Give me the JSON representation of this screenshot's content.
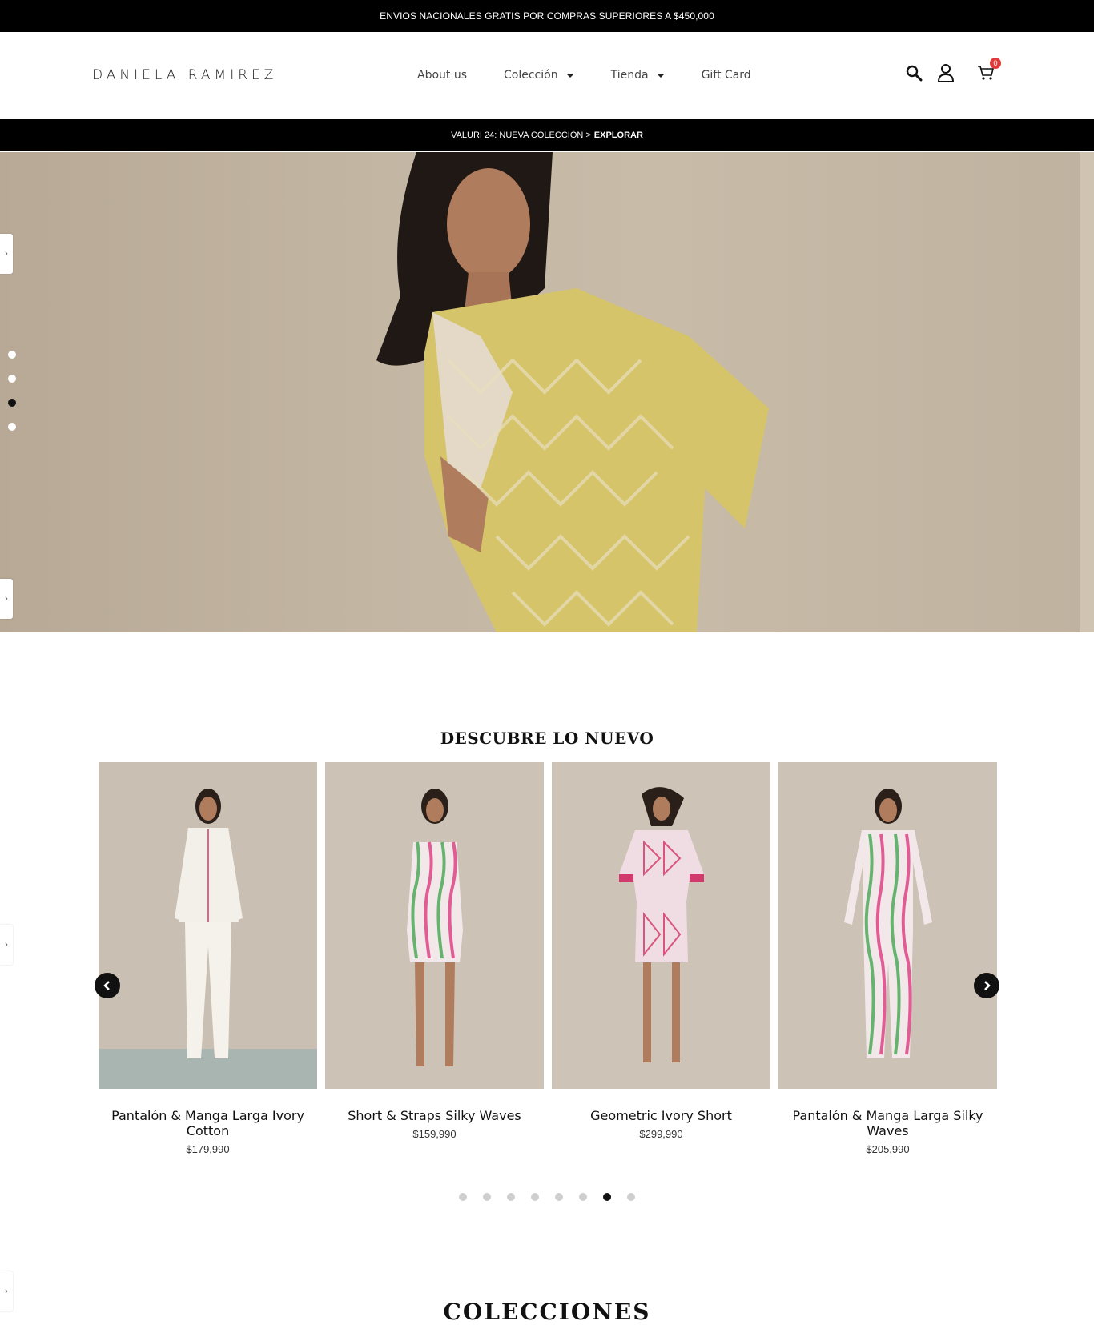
{
  "topbar": {
    "text": "ENVIOS NACIONALES GRATIS POR COMPRAS SUPERIORES A $450,000"
  },
  "header": {
    "logo": "DANIELA RAMIREZ",
    "nav": [
      {
        "label": "About us",
        "dropdown": false
      },
      {
        "label": "Colección",
        "dropdown": true
      },
      {
        "label": "Tienda",
        "dropdown": true
      },
      {
        "label": "Gift Card",
        "dropdown": false
      }
    ],
    "cart_count": "0",
    "icons": [
      "search-icon",
      "user-icon",
      "cart-icon"
    ]
  },
  "promobar": {
    "text": "VALURI 24: NUEVA COLECCIÓN >",
    "link": "EXPLORAR"
  },
  "hero": {
    "slides": 4,
    "active_slide": 3
  },
  "new_section": {
    "title": "DESCUBRE LO NUEVO",
    "products": [
      {
        "title": "Pantalón & Manga Larga Ivory Cotton",
        "price": "$179,990",
        "theme": "ivory"
      },
      {
        "title": "Short & Straps Silky Waves",
        "price": "$159,990",
        "theme": "waves-short"
      },
      {
        "title": "Geometric Ivory Short",
        "price": "$299,990",
        "theme": "geometric"
      },
      {
        "title": "Pantalón & Manga Larga Silky Waves",
        "price": "$205,990",
        "theme": "waves-long"
      }
    ],
    "pages": 8,
    "active_page": 7
  },
  "collections": {
    "title": "COLECCIONES"
  },
  "colors": {
    "accent": "#e03a3a",
    "dark": "#000000",
    "hero_bg": "#c3b6a3",
    "card_bg": "#c9bfb2"
  }
}
